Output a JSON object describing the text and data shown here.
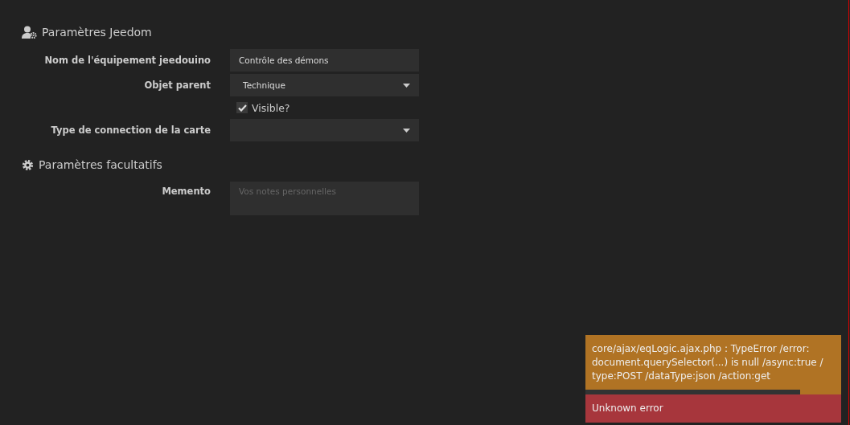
{
  "sections": [
    {
      "title": "Paramètres Jeedom",
      "rows": [
        {
          "kind": "text",
          "label": "Nom de l'équipement jeedouino",
          "value": "Contrôle des démons"
        },
        {
          "kind": "select",
          "label": "Objet parent",
          "value": "Technique"
        },
        {
          "kind": "checkbox",
          "text": "Visible?",
          "checked": true
        },
        {
          "kind": "select",
          "label": "Type de connection de la carte"
        }
      ]
    },
    {
      "title": "Paramètres facultatifs",
      "rows": [
        {
          "kind": "textarea",
          "label": "Memento",
          "placeholder": "Vos notes personnelles"
        }
      ]
    }
  ],
  "notifications": [
    {
      "kind": "warning",
      "text": "core/ajax/eqLogic.ajax.php : TypeError /error: document.querySelector(...) is null /async:true / type:POST /dataType:json /action:get",
      "level": 0.84
    },
    {
      "kind": "error",
      "text": "Unknown error"
    }
  ]
}
